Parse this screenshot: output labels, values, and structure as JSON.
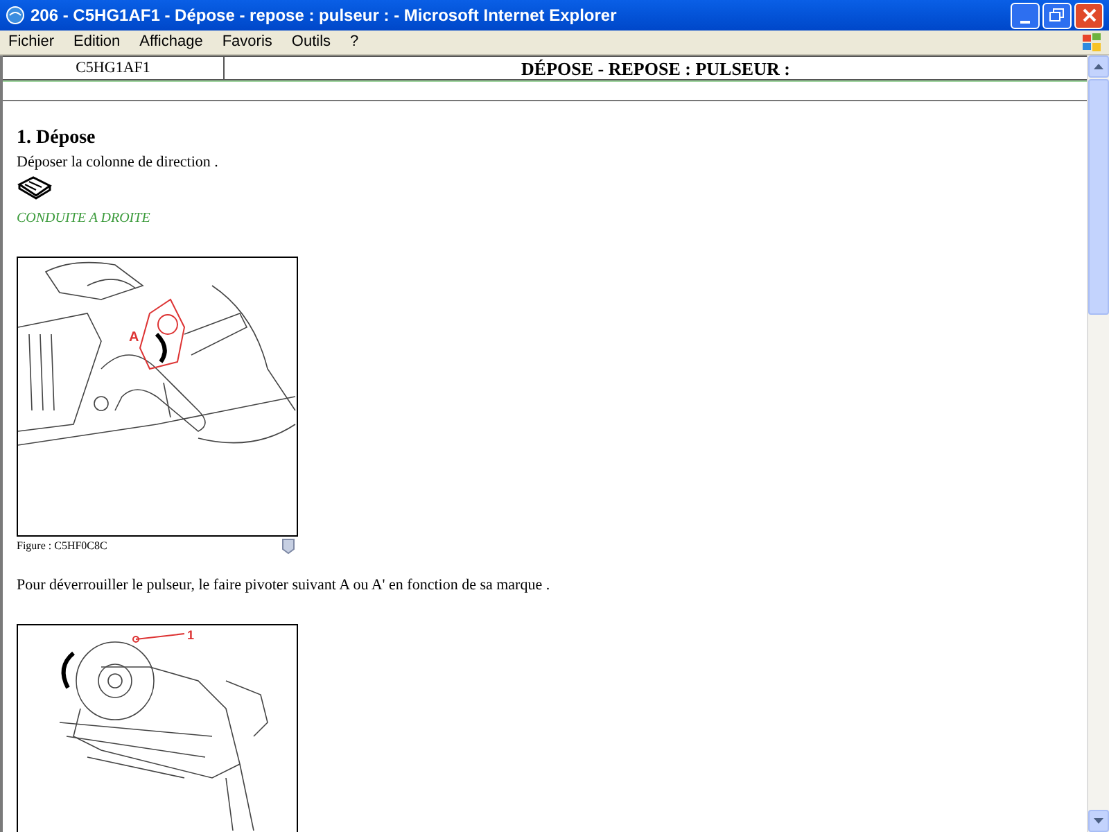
{
  "window": {
    "title": "206 - C5HG1AF1 - Dépose - repose : pulseur : - Microsoft Internet Explorer"
  },
  "menu": [
    "Fichier",
    "Edition",
    "Affichage",
    "Favoris",
    "Outils",
    "?"
  ],
  "header": {
    "code": "C5HG1AF1",
    "title": "DÉPOSE - REPOSE : PULSEUR :"
  },
  "section": {
    "heading": "1. Dépose",
    "instruction": "Déposer la colonne de direction .",
    "note": "CONDUITE A DROITE"
  },
  "figures": [
    {
      "callout": "A",
      "caption": "Figure : C5HF0C8C"
    },
    {
      "callout": "1"
    }
  ],
  "paragraphs": [
    "Pour déverrouiller le pulseur, le faire pivoter suivant A ou A' en fonction de sa marque ."
  ]
}
